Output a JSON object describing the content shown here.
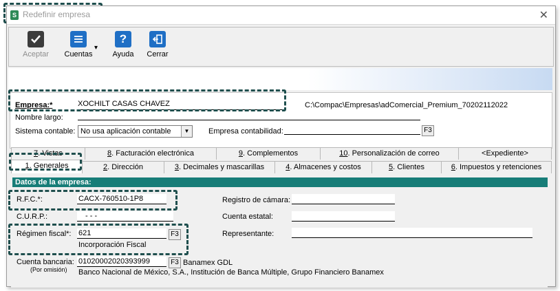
{
  "window": {
    "title": "Redefinir empresa",
    "close_glyph": "✕"
  },
  "toolbar": {
    "aceptar": "Aceptar",
    "cuentas": "Cuentas",
    "ayuda": "Ayuda",
    "cerrar": "Cerrar",
    "dropdown_glyph": "▾"
  },
  "header": {
    "empresa_label": "Empresa:*",
    "empresa_value": "XOCHILT CASAS CHAVEZ",
    "path": "C:\\Compac\\Empresas\\adComercial_Premium_70202112022",
    "nombre_largo_label": "Nombre largo:",
    "nombre_largo_value": "",
    "sistema_label": "Sistema contable:",
    "sistema_value": "No usa aplicación contable",
    "empresa_contab_label": "Empresa contabilidad:",
    "empresa_contab_value": "",
    "f3": "F3"
  },
  "tabs_row1": [
    {
      "num": "7",
      "rest": ". Vistas"
    },
    {
      "num": "8",
      "rest": ". Facturación electrónica"
    },
    {
      "num": "9",
      "rest": ". Complementos"
    },
    {
      "num": "10",
      "rest": ". Personalización de correo"
    },
    {
      "num": "",
      "rest": "<Expediente>"
    }
  ],
  "tabs_row2": [
    {
      "num": "1",
      "rest": ". Generales"
    },
    {
      "num": "2",
      "rest": ". Dirección"
    },
    {
      "num": "3",
      "rest": ". Decimales y mascarillas"
    },
    {
      "num": "4",
      "rest": ". Almacenes y costos"
    },
    {
      "num": "5",
      "rest": ". Clientes"
    },
    {
      "num": "6",
      "rest": ". Impuestos y retenciones"
    }
  ],
  "section": {
    "title": "Datos de la empresa:",
    "rfc_label": "R.F.C.*:",
    "rfc_value": "CACX-760510-1P8",
    "curp_label": "C.U.R.P.:",
    "curp_value": "-     -     -",
    "regimen_label": "Régimen fiscal*:",
    "regimen_value": "621",
    "regimen_desc": "Incorporación Fiscal",
    "cuenta_label": "Cuenta bancaria:",
    "cuenta_sub": "(Por omisión)",
    "cuenta_value": "01020002020393999",
    "banco_short": "Banamex GDL",
    "banco_long": "Banco Nacional de México, S.A., Institución de Banca Múltiple, Grupo Financiero Banamex",
    "registro_label": "Registro de cámara:",
    "registro_value": "",
    "cuenta_estatal_label": "Cuenta estatal:",
    "cuenta_estatal_value": "",
    "representante_label": "Representante:",
    "representante_value": ""
  },
  "colors": {
    "section_bar": "#177d78",
    "highlight": "#1f4f4e",
    "icon_blue": "#1f6fc5",
    "icon_dark": "#3c3c3c"
  },
  "icons": {
    "app": "app-logo-icon",
    "aceptar": "checkmark-icon",
    "cuentas": "list-document-icon",
    "ayuda": "help-question-icon",
    "cerrar": "exit-door-icon"
  }
}
